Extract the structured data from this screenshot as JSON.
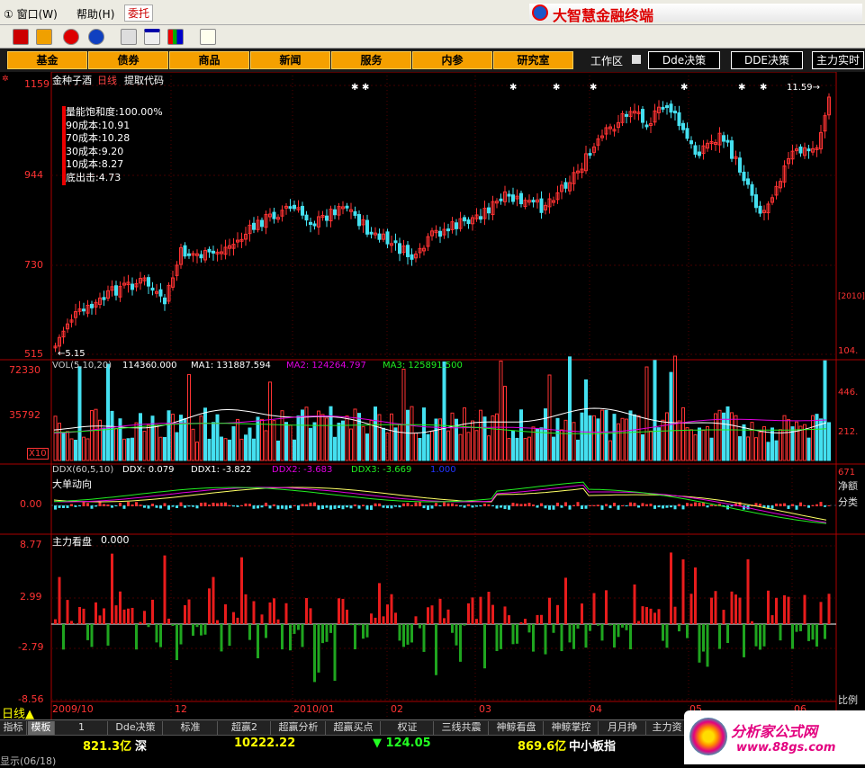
{
  "menu": {
    "items": [
      "① 窗口(W)",
      "帮助(H)",
      "委托"
    ],
    "brand": "大智慧金融终端"
  },
  "nav": {
    "buttons": [
      "基金",
      "债券",
      "商品",
      "新闻",
      "服务",
      "内参",
      "研究室"
    ],
    "workspace": "工作区",
    "links": [
      "Dde决策",
      "DDE决策",
      "主力实时"
    ]
  },
  "chart": {
    "title": "金种子酒",
    "period": "日线",
    "action": "提取代码",
    "price_axis": [
      "1159",
      "944",
      "730",
      "515"
    ],
    "info": [
      "量能饱和度:100.00%",
      "90成本:10.91",
      "70成本:10.28",
      "30成本:9.20",
      "10成本:8.27",
      "底出击:4.73"
    ],
    "low_marker": "←5.15",
    "high_marker": "11.59→",
    "vol_legend": {
      "prefix": "VOL(5,10,20)",
      "vol": "114360.000",
      "ma1": "MA1: 131887.594",
      "ma2": "MA2: 124264.797",
      "ma3": "MA3: 125891.500"
    },
    "vol_axis": [
      "72330",
      "35792"
    ],
    "vol_unit": "X10",
    "ddx_legend": {
      "prefix": "DDX(60,5,10)",
      "ddx": "DDX: 0.079",
      "ddx1": "DDX1: -3.822",
      "ddx2": "DDX2: -3.683",
      "ddx3": "DDX3: -3.669",
      "val": "1.000"
    },
    "ddx_title": "大单动向",
    "ddx_axis": "0.00",
    "main_title": "主力看盘",
    "main_value": "0.000",
    "main_axis": [
      "8.77",
      "2.99",
      "-2.79",
      "-8.56"
    ],
    "right_axis": [
      "104.",
      "446.",
      "212.",
      "671",
      "净额",
      "分类",
      "比例"
    ],
    "right_code": "[2010]",
    "dates": [
      "2009/10",
      "12",
      "2010/01",
      "02",
      "03",
      "04",
      "05",
      "06"
    ],
    "period_label": "日线▲"
  },
  "chart_data": {
    "type": "candlestick",
    "title": "金种子酒 日线",
    "ylim": [
      5.15,
      11.59
    ],
    "y_ticks": [
      11.59,
      9.44,
      7.3,
      5.15
    ],
    "x_labels": [
      "2009/10",
      "12",
      "2010/01",
      "02",
      "03",
      "04",
      "05",
      "06"
    ],
    "indicators": [
      "VOL(5,10,20)",
      "DDX(60,5,10)",
      "主力看盘"
    ]
  },
  "tabs": [
    "指标",
    "模板",
    "1",
    "Dde决策",
    "标准",
    "超赢2",
    "超赢分析",
    "超赢买点",
    "权证",
    "三线共震",
    "神鲸看盘",
    "神鲸掌控",
    "月月挣",
    "主力资"
  ],
  "status": {
    "amount1": "821.3亿",
    "market1": "深",
    "index": "10222.22",
    "change": "▼ 124.05",
    "amount2": "869.6亿",
    "market2": "中小板指",
    "bottom": "显示(06/18)"
  },
  "watermark": {
    "title": "分析家公式网",
    "url": "www.88gs.com"
  },
  "colors": {
    "up": "#ff3333",
    "down": "#44e0f0",
    "ma1": "#ffffff",
    "ma2": "#e000e0",
    "ma3": "#22ee22",
    "nav": "#f5a000"
  }
}
